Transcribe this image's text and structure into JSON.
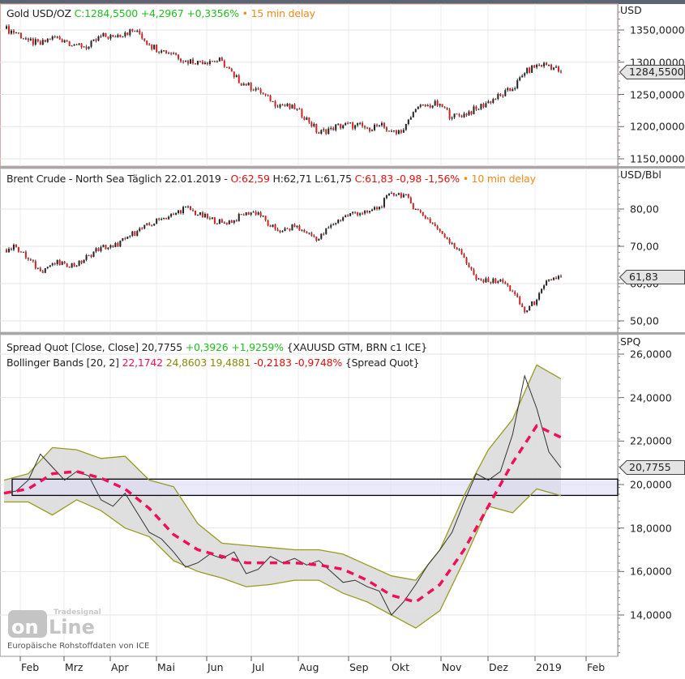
{
  "colors": {
    "up": "#222222",
    "down": "#d42020",
    "mid_band": "#f0105a",
    "band_line": "#9a9a20",
    "band_fill": "#dddddd",
    "range_box": "#dcdcf8"
  },
  "logo": {
    "brand": "Tradesignal online",
    "source_note": "Europäische Rohstoffdaten von ICE"
  },
  "chart_data": [
    {
      "type": "candlestick",
      "title": "Gold USD/OZ",
      "close_label": "C:1284,5500",
      "change": "+4,2967",
      "change_pct": "+0,3356%",
      "delay": "15 min delay",
      "unit": "USD",
      "yticks": [
        1350,
        1300,
        1250,
        1200,
        1150
      ],
      "ytick_labels": [
        "1350,0000",
        "1300,0000",
        "1250,0000",
        "1200,0000",
        "1150,0000"
      ],
      "ylim": [
        1140,
        1365
      ],
      "last_label": "1284,5500",
      "last": 1284.55,
      "closes": [
        1352,
        1346,
        1334,
        1327,
        1340,
        1334,
        1327,
        1324,
        1340,
        1340,
        1346,
        1349,
        1327,
        1318,
        1314,
        1302,
        1302,
        1302,
        1302,
        1277,
        1264,
        1258,
        1239,
        1233,
        1227,
        1214,
        1189,
        1198,
        1202,
        1202,
        1198,
        1202,
        1193,
        1195,
        1227,
        1233,
        1235,
        1214,
        1220,
        1227,
        1239,
        1248,
        1258,
        1283,
        1296,
        1296,
        1284.55
      ]
    },
    {
      "type": "candlestick",
      "title": "Brent Crude - North Sea Täglich 22.01.2019 -",
      "open": "O:62,59",
      "high": "H:62,71",
      "low": "L:61,75",
      "close_label": "C:61,83",
      "change": "-0,98",
      "change_pct": "-1,56%",
      "delay": "10 min delay",
      "unit": "USD/Bbl",
      "yticks": [
        80,
        70,
        60,
        50
      ],
      "ytick_labels": [
        "80,00",
        "70,00",
        "60,00",
        "50,00"
      ],
      "ylim": [
        47,
        91
      ],
      "last_label": "61,83",
      "last": 61.83,
      "closes": [
        69.1,
        69.8,
        66.5,
        63.3,
        65.4,
        65.4,
        64.8,
        67.6,
        69.8,
        69.8,
        72.0,
        74.1,
        75.7,
        77.4,
        78.5,
        80.6,
        78.5,
        77.4,
        76.3,
        77.0,
        79.1,
        79.1,
        75.2,
        74.1,
        75.2,
        73.5,
        72.0,
        75.7,
        77.8,
        79.1,
        79.1,
        80.6,
        84.3,
        83.9,
        80.0,
        77.4,
        74.1,
        70.9,
        67.0,
        61.1,
        60.4,
        61.1,
        57.8,
        52.4,
        55.7,
        61.1,
        61.83
      ]
    },
    {
      "type": "line",
      "title": "Spread Quot [Close, Close]",
      "value": "20,7755",
      "change": "+0,3926",
      "change_pct": "+1,9259%",
      "sources": "{XAUUSD GTM, BRN c1 ICE}",
      "bb_title": "Bollinger Bands [20, 2]",
      "bb_mid": "22,1742",
      "bb_upper": "24,8603",
      "bb_lower": "19,4881",
      "bb_change": "-0,2183",
      "bb_change_pct": "-0,9748%",
      "bb_source": "{Spread Quot}",
      "unit": "SPQ",
      "yticks": [
        26,
        24,
        22,
        20,
        18,
        16,
        14
      ],
      "ytick_labels": [
        "26,0000",
        "24,0000",
        "22,0000",
        "20,0000",
        "18,0000",
        "16,0000",
        "14,0000"
      ],
      "ylim": [
        12.2,
        26.9
      ],
      "last_label": "20,7755",
      "last": 20.7755,
      "range_box": [
        19.5,
        20.25
      ],
      "close": [
        19.6,
        19.7,
        20.2,
        21.4,
        20.8,
        20.2,
        20.6,
        20.4,
        19.3,
        19.0,
        19.6,
        18.7,
        17.8,
        17.5,
        16.9,
        16.2,
        16.4,
        16.8,
        16.6,
        16.9,
        15.9,
        16.1,
        16.7,
        16.4,
        16.6,
        16.3,
        16.5,
        16.0,
        15.5,
        15.6,
        15.3,
        15.1,
        14.0,
        14.6,
        15.4,
        16.3,
        17.0,
        17.8,
        19.2,
        20.5,
        20.2,
        20.6,
        22.3,
        25.0,
        23.5,
        21.5,
        20.7755
      ],
      "bb_mid_series": [
        19.6,
        19.8,
        20.5,
        20.6,
        20.3,
        19.8,
        18.9,
        17.7,
        17.0,
        16.7,
        16.4,
        16.4,
        16.4,
        16.3,
        16.1,
        15.6,
        14.9,
        14.6,
        15.4,
        17.0,
        19.0,
        21.0,
        22.7,
        22.17
      ],
      "bb_upper_series": [
        20.2,
        20.5,
        21.7,
        21.6,
        21.2,
        21.3,
        20.2,
        19.9,
        18.2,
        17.3,
        17.2,
        17.1,
        17.0,
        17.0,
        16.8,
        16.3,
        15.8,
        15.6,
        17.0,
        19.5,
        21.6,
        23.0,
        25.5,
        24.86
      ],
      "bb_lower_series": [
        19.2,
        19.2,
        18.6,
        19.3,
        18.8,
        18.0,
        17.6,
        16.5,
        16.0,
        15.7,
        15.3,
        15.4,
        15.6,
        15.6,
        15.0,
        14.6,
        14.0,
        13.4,
        14.2,
        16.5,
        19.0,
        18.7,
        19.8,
        19.49
      ]
    }
  ],
  "x_axis": {
    "labels": [
      "Feb",
      "Mrz",
      "Apr",
      "Mai",
      "Jun",
      "Jul",
      "Aug",
      "Sep",
      "Okt",
      "Nov",
      "Dez",
      "2019",
      "Feb"
    ]
  }
}
